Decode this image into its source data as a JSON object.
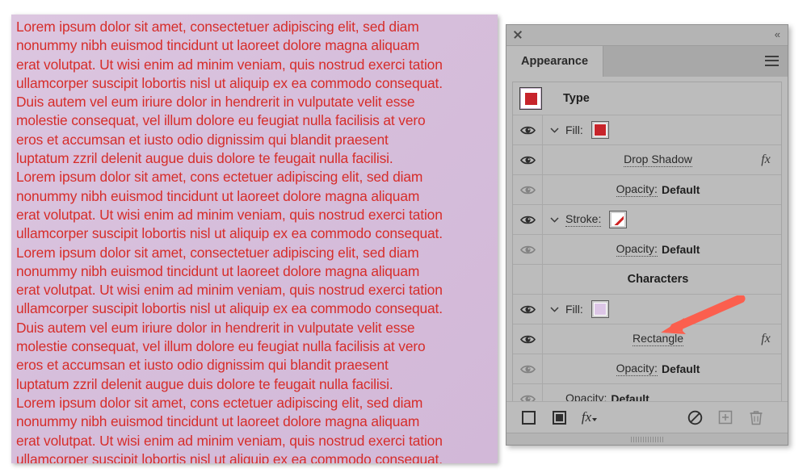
{
  "artwork": {
    "name": "lorem-text-block",
    "text_color": "#d62d2a",
    "background_color": "#d6bedb",
    "lines": [
      "Lorem ipsum dolor sit amet, consectetuer adipiscing elit, sed diam",
      "nonummy nibh euismod tincidunt ut laoreet dolore magna aliquam",
      "erat volutpat. Ut wisi enim ad minim veniam, quis nostrud exerci tation",
      "ullamcorper suscipit lobortis nisl ut aliquip ex ea commodo consequat.",
      "Duis autem vel eum iriure dolor in hendrerit in vulputate velit esse",
      "molestie consequat, vel illum dolore eu feugiat nulla facilisis at vero",
      "eros et accumsan et iusto odio dignissim qui blandit praesent",
      "luptatum zzril delenit augue duis dolore te feugait nulla facilisi.",
      "Lorem ipsum dolor sit amet, cons ectetuer adipiscing elit, sed diam",
      "nonummy nibh euismod tincidunt ut laoreet dolore magna aliquam",
      "erat volutpat. Ut wisi enim ad minim veniam, quis nostrud exerci tation",
      "ullamcorper suscipit lobortis nisl ut aliquip ex ea commodo consequat.",
      "Lorem ipsum dolor sit amet, consectetuer adipiscing elit, sed diam",
      "nonummy nibh euismod tincidunt ut laoreet dolore magna aliquam",
      "erat volutpat. Ut wisi enim ad minim veniam, quis nostrud exerci tation",
      "ullamcorper suscipit lobortis nisl ut aliquip ex ea commodo consequat.",
      "Duis autem vel eum iriure dolor in hendrerit in vulputate velit esse",
      "molestie consequat, vel illum dolore eu feugiat nulla facilisis at vero",
      "eros et accumsan et iusto odio dignissim qui blandit praesent",
      "luptatum zzril delenit augue duis dolore te feugait nulla facilisi.",
      "Lorem ipsum dolor sit amet, cons ectetuer adipiscing elit, sed diam",
      "nonummy nibh euismod tincidunt ut laoreet dolore magna aliquam",
      "erat volutpat. Ut wisi enim ad minim veniam, quis nostrud exerci tation",
      "ullamcorper suscipit lobortis nisl ut aliquip ex ea commodo consequat."
    ]
  },
  "panel": {
    "close_icon": "close-icon",
    "collapse_label": "«",
    "tab_label": "Appearance",
    "menu_icon": "hamburger-menu-icon",
    "object_row": {
      "label": "Type",
      "thumbnail_color": "#c7252b"
    },
    "rows": [
      {
        "id": "fill-type",
        "label": "Fill:",
        "value": "",
        "eye": "visible",
        "chevron": true,
        "swatch": "#c7252b",
        "swatch_kind": "color",
        "fx": false,
        "indent": 0,
        "underline": "none"
      },
      {
        "id": "drop-shadow",
        "label": "Drop Shadow",
        "value": "",
        "eye": "visible",
        "chevron": false,
        "swatch": null,
        "swatch_kind": "none",
        "fx": true,
        "indent": 1,
        "underline": "both"
      },
      {
        "id": "opacity-fill-type",
        "label": "Opacity:",
        "value": "Default",
        "eye": "hidden",
        "chevron": false,
        "swatch": null,
        "swatch_kind": "none",
        "fx": false,
        "indent": 1,
        "underline": "both"
      },
      {
        "id": "stroke-type",
        "label": "Stroke:",
        "value": "",
        "eye": "visible",
        "chevron": true,
        "swatch": "none",
        "swatch_kind": "slash",
        "fx": false,
        "indent": 0,
        "underline": "dotted"
      },
      {
        "id": "opacity-stroke-type",
        "label": "Opacity:",
        "value": "Default",
        "eye": "hidden",
        "chevron": false,
        "swatch": null,
        "swatch_kind": "none",
        "fx": false,
        "indent": 1,
        "underline": "both"
      },
      {
        "id": "characters",
        "label": "Characters",
        "value": "",
        "eye": "none",
        "chevron": false,
        "swatch": null,
        "swatch_kind": "none",
        "fx": false,
        "indent": 0,
        "underline": "none"
      },
      {
        "id": "fill-characters",
        "label": "Fill:",
        "value": "",
        "eye": "visible",
        "chevron": true,
        "swatch": "#dcc6e6",
        "swatch_kind": "color",
        "fx": false,
        "indent": 0,
        "underline": "none"
      },
      {
        "id": "rectangle",
        "label": "Rectangle",
        "value": "",
        "eye": "visible",
        "chevron": false,
        "swatch": null,
        "swatch_kind": "none",
        "fx": true,
        "indent": 1,
        "underline": "both"
      },
      {
        "id": "opacity-fill-characters",
        "label": "Opacity:",
        "value": "Default",
        "eye": "hidden",
        "chevron": false,
        "swatch": null,
        "swatch_kind": "none",
        "fx": false,
        "indent": 1,
        "underline": "both"
      },
      {
        "id": "opacity-object",
        "label": "Opacity:",
        "value": "Default",
        "eye": "hidden",
        "chevron": false,
        "swatch": null,
        "swatch_kind": "none",
        "fx": false,
        "indent": 0,
        "underline": "both"
      }
    ],
    "footer": {
      "new_fill_icon": "new-fill-icon",
      "new_stroke_icon": "new-stroke-icon",
      "fx_label": "fx",
      "clear_icon": "clear-appearance-icon",
      "duplicate_icon": "duplicate-item-icon",
      "delete_icon": "delete-item-icon"
    }
  },
  "annotation": {
    "arrow_color": "#fb5f4e",
    "points_to": "Rectangle"
  }
}
